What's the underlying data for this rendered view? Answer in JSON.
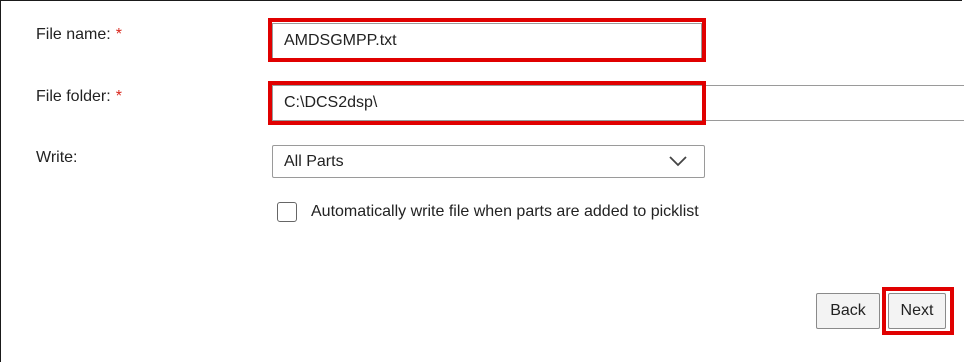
{
  "form": {
    "file_name": {
      "label": "File name:",
      "required_mark": "*",
      "value": "AMDSGMPP.txt"
    },
    "file_folder": {
      "label": "File folder:",
      "required_mark": "*",
      "value": "C:\\DCS2dsp\\"
    },
    "write": {
      "label": "Write:",
      "selected": "All Parts"
    },
    "auto_write": {
      "label": "Automatically write file when parts are added to picklist",
      "checked": false
    }
  },
  "buttons": {
    "back": "Back",
    "next": "Next"
  },
  "colors": {
    "highlight": "#e00000",
    "required": "#d9261c"
  },
  "icons": {
    "dropdown": "chevron-down-icon"
  }
}
